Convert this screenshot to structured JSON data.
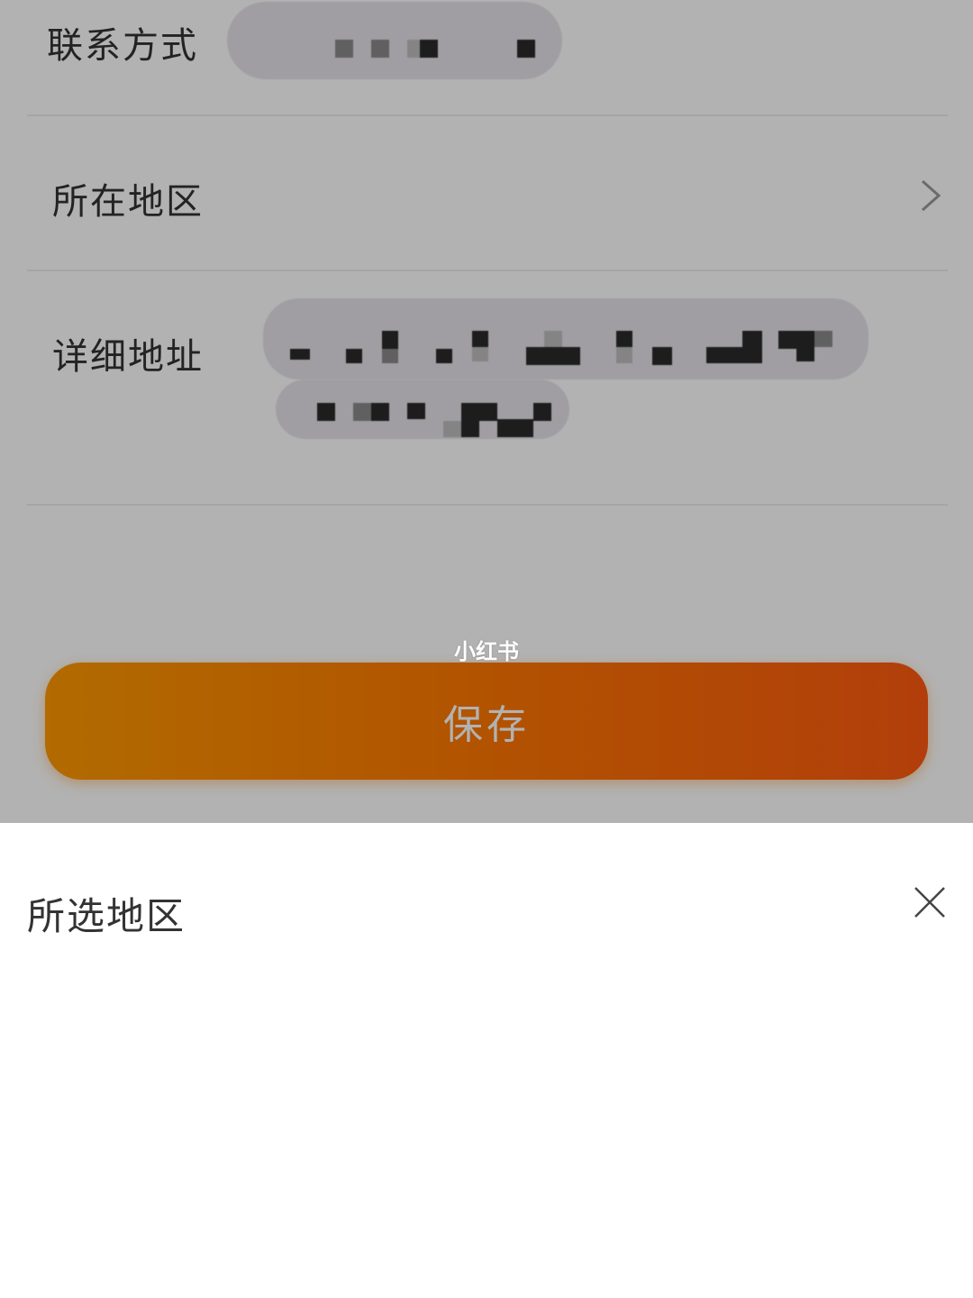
{
  "form": {
    "contact_label": "联系方式",
    "region_label": "所在地区",
    "address_label": "详细地址",
    "save_label": "保存"
  },
  "watermark": "小红书",
  "region_sheet": {
    "title": "所选地区"
  },
  "icons": {
    "region_chevron": "chevron-right-icon",
    "sheet_close": "close-icon"
  },
  "colors": {
    "save_gradient_start": "#ff9a00",
    "save_gradient_end": "#ff5a10",
    "overlay": "rgba(0,0,0,0.30)"
  }
}
